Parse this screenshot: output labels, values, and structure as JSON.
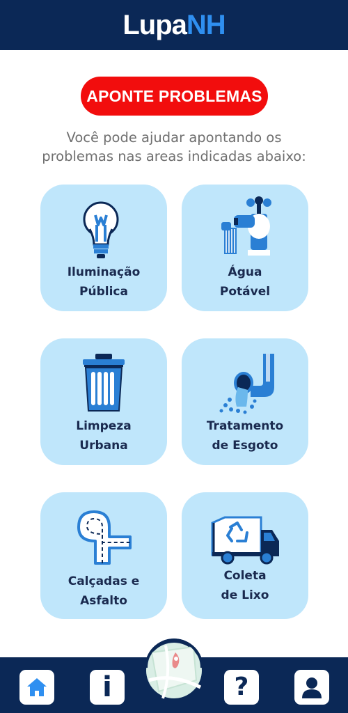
{
  "header": {
    "logo_part1": "Lupa",
    "logo_part2": "NH"
  },
  "cta": {
    "label": "APONTE PROBLEMAS"
  },
  "intro": {
    "line1": "Você pode ajudar apontando os",
    "line2": "problemas nas areas indicadas abaixo:"
  },
  "categories": [
    {
      "line1": "Iluminação",
      "line2": "Pública",
      "icon": "light-bulb-icon"
    },
    {
      "line1": "Água",
      "line2": "Potável",
      "icon": "water-faucet-icon"
    },
    {
      "line1": "Limpeza",
      "line2": "Urbana",
      "icon": "trash-can-icon"
    },
    {
      "line1": "Tratamento",
      "line2": "de Esgoto",
      "icon": "sewage-pipe-icon"
    },
    {
      "line1": "Calçadas e",
      "line2": "Asfalto",
      "icon": "road-icon"
    },
    {
      "line1": "Coleta",
      "line2": "de Lixo",
      "icon": "garbage-truck-icon"
    }
  ],
  "bottom_nav": {
    "items": [
      {
        "icon": "home-icon"
      },
      {
        "icon": "info-icon"
      },
      {
        "icon": "map-icon"
      },
      {
        "icon": "question-icon"
      },
      {
        "icon": "user-icon"
      }
    ],
    "info_glyph": "i",
    "help_glyph": "?"
  },
  "colors": {
    "navy": "#0b2856",
    "accent_blue": "#2f8ff0",
    "cta_red": "#f20d0d",
    "card_bg": "#bfe6fb",
    "icon_blue": "#2a7fd4"
  }
}
